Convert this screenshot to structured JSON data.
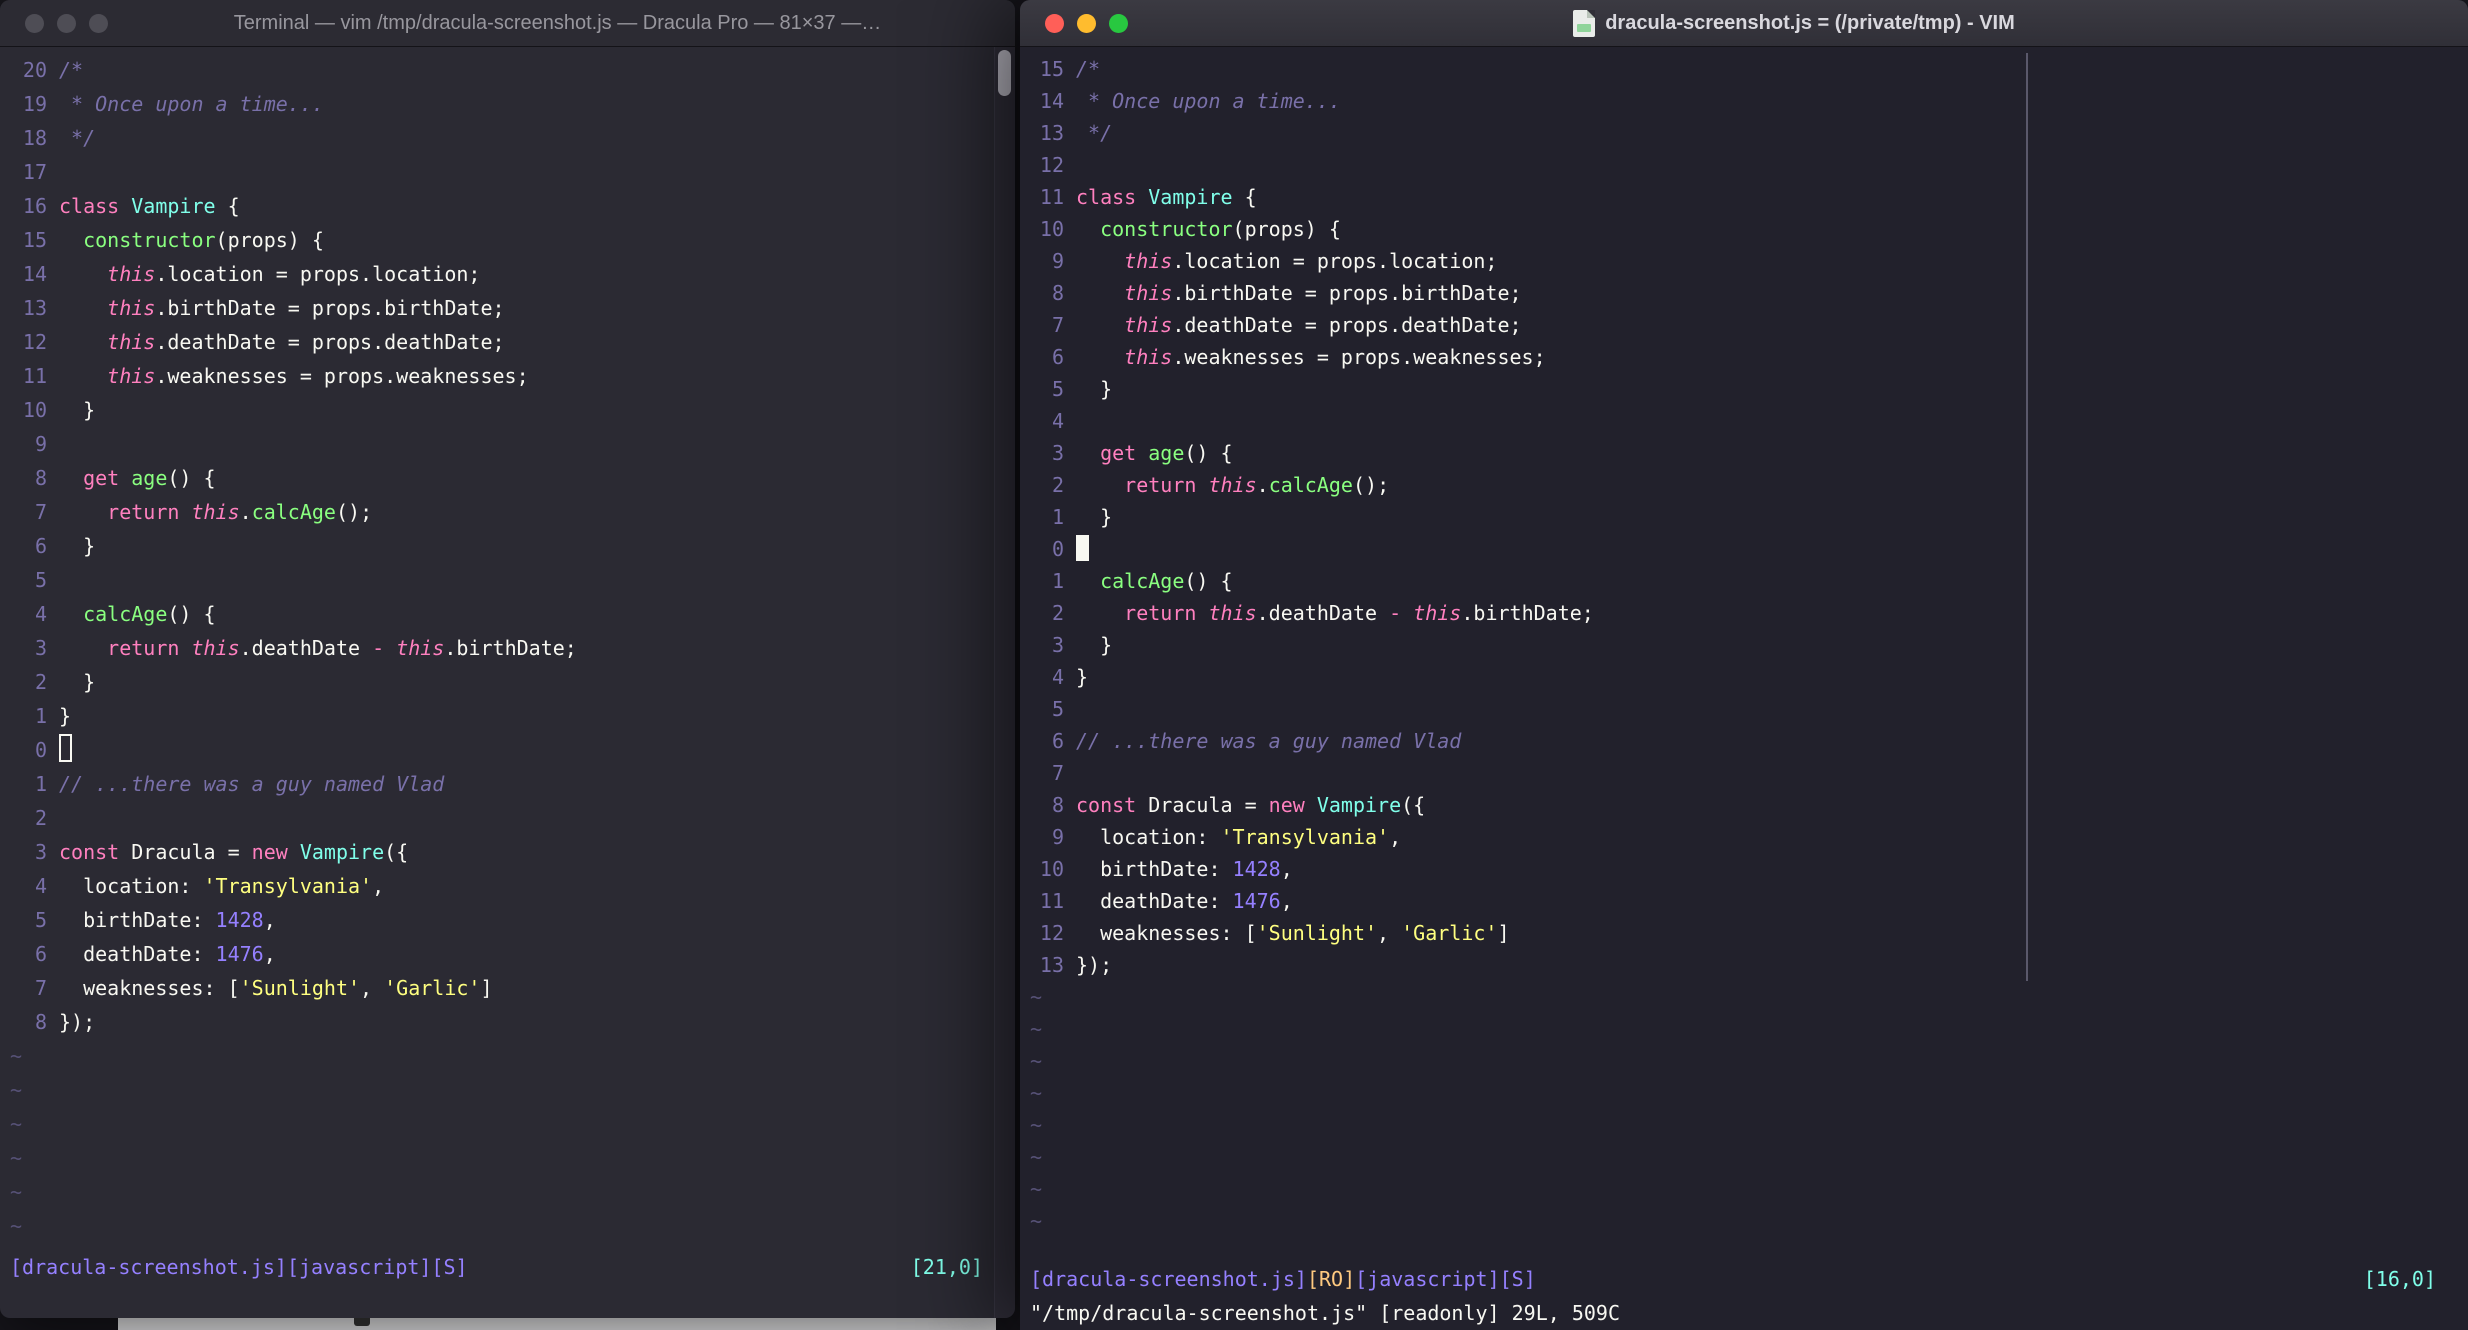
{
  "colors": {
    "bg_left": "#2B2A33",
    "bg_right": "#22212C",
    "fg": "#F8F8F2",
    "comment": "#7970A9",
    "pink": "#FF80BF",
    "green": "#8AFF80",
    "cyan": "#80FFEA",
    "purple": "#9580FF",
    "yellow": "#FFFF80",
    "orange": "#FFCA80",
    "linenr": "#7970A9",
    "tilde": "#565176",
    "tl_red": "#FF5F58",
    "tl_yellow": "#FFBC2E",
    "tl_green": "#28C840"
  },
  "icons": {
    "traffic_lights": [
      "close-button",
      "minimize-button",
      "zoom-button"
    ],
    "file_proxy": "document-icon"
  },
  "tilde_char": "~",
  "left_window": {
    "titlebar": {
      "title": "Terminal — vim /tmp/dracula-screenshot.js — Dracula Pro — 81×37 —…"
    },
    "rel_numbers": [
      "20",
      "19",
      "18",
      "17",
      "16",
      "15",
      "14",
      "13",
      "12",
      "11",
      "10",
      "9",
      "8",
      "7",
      "6",
      "5",
      "4",
      "3",
      "2",
      "1",
      "0",
      "1",
      "2",
      "3",
      "4",
      "5",
      "6",
      "7",
      "8"
    ],
    "cursor_row": 20,
    "cursor_style": "hollow",
    "tilde_count": 6,
    "status_segments": [
      [
        "pu",
        "[dracula-screenshot.js][javascript][S]"
      ]
    ],
    "status_right": "[21,0]",
    "cmdline": ""
  },
  "right_window": {
    "titlebar": {
      "title": "dracula-screenshot.js = (/private/tmp) - VIM"
    },
    "rel_numbers": [
      "15",
      "14",
      "13",
      "12",
      "11",
      "10",
      "9",
      "8",
      "7",
      "6",
      "5",
      "4",
      "3",
      "2",
      "1",
      "0",
      "1",
      "2",
      "3",
      "4",
      "5",
      "6",
      "7",
      "8",
      "9",
      "10",
      "11",
      "12",
      "13"
    ],
    "cursor_row": 15,
    "cursor_style": "block",
    "tilde_count": 8,
    "status_segments": [
      [
        "pu",
        "[dracula-screenshot.js]"
      ],
      [
        "o",
        "[RO]"
      ],
      [
        "pu",
        "[javascript][S]"
      ]
    ],
    "status_right": "[16,0]",
    "cmdline": "\"/tmp/dracula-screenshot.js\" [readonly] 29L, 509C"
  },
  "code_lines": [
    [
      [
        "c",
        "/*"
      ]
    ],
    [
      [
        "c",
        " * Once upon a time..."
      ]
    ],
    [
      [
        "c",
        " */"
      ]
    ],
    [],
    [
      [
        "p",
        "class"
      ],
      [
        "f",
        " "
      ],
      [
        "cy",
        "Vampire"
      ],
      [
        "f",
        " {"
      ]
    ],
    [
      [
        "f",
        "  "
      ],
      [
        "g",
        "constructor"
      ],
      [
        "f",
        "(props) {"
      ]
    ],
    [
      [
        "f",
        "    "
      ],
      [
        "pi",
        "this"
      ],
      [
        "f",
        ".location = props.location;"
      ]
    ],
    [
      [
        "f",
        "    "
      ],
      [
        "pi",
        "this"
      ],
      [
        "f",
        ".birthDate = props.birthDate;"
      ]
    ],
    [
      [
        "f",
        "    "
      ],
      [
        "pi",
        "this"
      ],
      [
        "f",
        ".deathDate = props.deathDate;"
      ]
    ],
    [
      [
        "f",
        "    "
      ],
      [
        "pi",
        "this"
      ],
      [
        "f",
        ".weaknesses = props.weaknesses;"
      ]
    ],
    [
      [
        "f",
        "  }"
      ]
    ],
    [],
    [
      [
        "f",
        "  "
      ],
      [
        "p",
        "get"
      ],
      [
        "f",
        " "
      ],
      [
        "g",
        "age"
      ],
      [
        "f",
        "() {"
      ]
    ],
    [
      [
        "f",
        "    "
      ],
      [
        "p",
        "return"
      ],
      [
        "f",
        " "
      ],
      [
        "pi",
        "this"
      ],
      [
        "f",
        "."
      ],
      [
        "g",
        "calcAge"
      ],
      [
        "f",
        "();"
      ]
    ],
    [
      [
        "f",
        "  }"
      ]
    ],
    [],
    [
      [
        "f",
        "  "
      ],
      [
        "g",
        "calcAge"
      ],
      [
        "f",
        "() {"
      ]
    ],
    [
      [
        "f",
        "    "
      ],
      [
        "p",
        "return"
      ],
      [
        "f",
        " "
      ],
      [
        "pi",
        "this"
      ],
      [
        "f",
        ".deathDate "
      ],
      [
        "p",
        "-"
      ],
      [
        "f",
        " "
      ],
      [
        "pi",
        "this"
      ],
      [
        "f",
        ".birthDate;"
      ]
    ],
    [
      [
        "f",
        "  }"
      ]
    ],
    [
      [
        "f",
        "}"
      ]
    ],
    [],
    [
      [
        "c",
        "// ...there was a guy named Vlad"
      ]
    ],
    [],
    [
      [
        "p",
        "const"
      ],
      [
        "f",
        " Dracula = "
      ],
      [
        "p",
        "new"
      ],
      [
        "f",
        " "
      ],
      [
        "cy",
        "Vampire"
      ],
      [
        "f",
        "({"
      ]
    ],
    [
      [
        "f",
        "  location: "
      ],
      [
        "y",
        "'Transylvania'"
      ],
      [
        "f",
        ","
      ]
    ],
    [
      [
        "f",
        "  birthDate: "
      ],
      [
        "pu",
        "1428"
      ],
      [
        "f",
        ","
      ]
    ],
    [
      [
        "f",
        "  deathDate: "
      ],
      [
        "pu",
        "1476"
      ],
      [
        "f",
        ","
      ]
    ],
    [
      [
        "f",
        "  weaknesses: ["
      ],
      [
        "y",
        "'Sunlight'"
      ],
      [
        "f",
        ", "
      ],
      [
        "y",
        "'Garlic'"
      ],
      [
        "f",
        "]"
      ]
    ],
    [
      [
        "f",
        "});"
      ]
    ]
  ]
}
